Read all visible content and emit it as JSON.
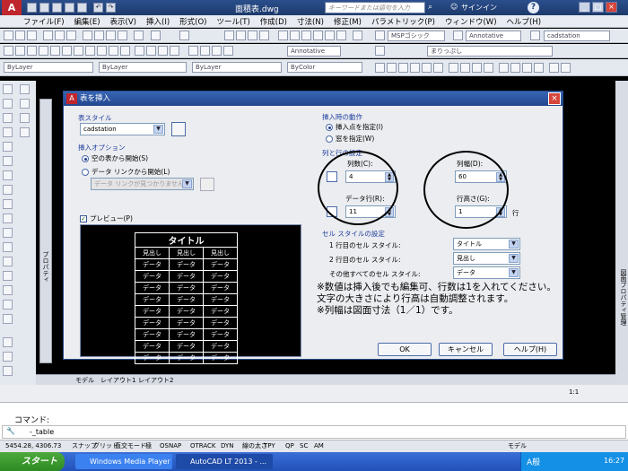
{
  "app": {
    "logo": "A",
    "title": "面積表.dwg",
    "search_placeholder": "キーワードまたは語句を入力",
    "signin": "サインイン",
    "help_symbol": "?"
  },
  "menu": [
    "ファイル(F)",
    "編集(E)",
    "表示(V)",
    "挿入(I)",
    "形式(O)",
    "ツール(T)",
    "作成(D)",
    "寸法(N)",
    "修正(M)",
    "パラメトリック(P)",
    "ウィンドウ(W)",
    "ヘルプ(H)"
  ],
  "toolbars": {
    "text_style": "MSPゴシック",
    "annotative1": "Annotative",
    "table_style": "cadstation",
    "annotative2": "Annotative",
    "layer_combo": "まりっぷし",
    "bylayer1": "ByLayer",
    "bylayer2": "ByLayer",
    "bylayer3": "ByLayer",
    "bycolor": "ByColor"
  },
  "dialog": {
    "title": "表を挿入",
    "close": "×",
    "table_style_label": "表スタイル",
    "table_style_value": "cadstation",
    "insert_options_label": "挿入オプション",
    "opt_empty": "空の表から開始(S)",
    "opt_datalink": "データ リンクから開始(L)",
    "datalink_placeholder": "データ リンクが見つかりません",
    "opt_extract": "",
    "preview_label": "プレビュー(P)",
    "preview": {
      "title": "タイトル",
      "headers": [
        "見出し",
        "見出し",
        "見出し"
      ],
      "data_cell": "データ",
      "data_rows": 9
    },
    "insert_behavior_label": "挿入時の動作",
    "beh_point": "挿入点を指定(I)",
    "beh_window": "窓を指定(W)",
    "col_row_label": "列と行の設定",
    "columns_label": "列数(C):",
    "columns_value": "4",
    "col_width_label": "列幅(D):",
    "col_width_value": "60",
    "data_rows_label": "データ行(R):",
    "data_rows_value": "11",
    "row_height_label": "行高さ(G):",
    "row_height_value": "1",
    "row_unit": "行",
    "cell_style_label": "セル スタイルの設定",
    "first_row_label": "1 行目のセル スタイル:",
    "first_row_value": "タイトル",
    "second_row_label": "2 行目のセル スタイル:",
    "second_row_value": "見出し",
    "other_rows_label": "その他すべてのセル スタイル:",
    "other_rows_value": "データ",
    "ok": "OK",
    "cancel": "キャンセル",
    "help": "ヘルプ(H)"
  },
  "note": {
    "line1": "※数値は挿入後でも編集可、行数は1を入れてください。文字の大きさにより行高は自動調整されます。",
    "line2": "※列幅は図面寸法（1／1）です。"
  },
  "tabs": [
    "モデル",
    "レイアウト1",
    "レイアウト2"
  ],
  "side_panels": {
    "left": "プロパティ",
    "right": "図面プロパティ管理"
  },
  "command": {
    "label": "コマンド:",
    "input": "-_table"
  },
  "status": {
    "coords": "5454.28, 4306.73",
    "toggles": [
      "スナップ",
      "グリッド",
      "直交モード",
      "極",
      "OSNAP",
      "OTRACK",
      "DYN",
      "線の太さ",
      "TPY",
      "QP",
      "SC",
      "AM"
    ],
    "model": "モデル",
    "scale": "1:1"
  },
  "taskbar": {
    "start": "スタート",
    "items": [
      "Windows Media Player",
      "AutoCAD LT 2013 - ..."
    ],
    "ime": "A般",
    "clock": "16:27"
  },
  "colors": {
    "title_blue": "#23488e",
    "autocad_red": "#c0262d",
    "start_green": "#2d8a24"
  }
}
